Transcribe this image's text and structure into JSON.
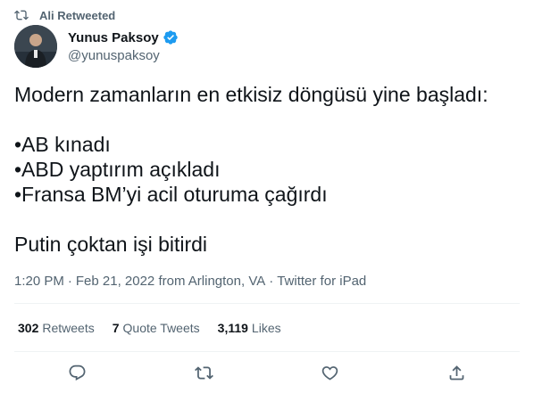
{
  "retweet_context": {
    "label": "Ali Retweeted",
    "icon": "retweet-icon"
  },
  "author": {
    "name": "Yunus Paksoy",
    "handle": "@yunuspaksoy",
    "verified": true,
    "verified_color": "#1d9bf0"
  },
  "tweet": {
    "lines": [
      "Modern zamanların en etkisiz döngüsü yine başladı:",
      "•AB kınadı",
      "•ABD yaptırım açıkladı",
      "•Fransa BM’yi acil oturuma çağırdı",
      "Putin çoktan işi bitirdi"
    ]
  },
  "meta": {
    "time": "1:20 PM",
    "separator": "·",
    "date": "Feb 21, 2022 from Arlington, VA",
    "source": "Twitter for iPad"
  },
  "stats": {
    "retweets": {
      "count": "302",
      "label": "Retweets"
    },
    "quote_tweets": {
      "count": "7",
      "label": "Quote Tweets"
    },
    "likes": {
      "count": "3,119",
      "label": "Likes"
    }
  },
  "actions": [
    {
      "icon": "reply-icon"
    },
    {
      "icon": "retweet-icon"
    },
    {
      "icon": "like-icon"
    },
    {
      "icon": "share-icon"
    }
  ],
  "colors": {
    "text_primary": "#0f1419",
    "text_secondary": "#536471",
    "divider": "#eff3f4",
    "verified": "#1d9bf0"
  }
}
